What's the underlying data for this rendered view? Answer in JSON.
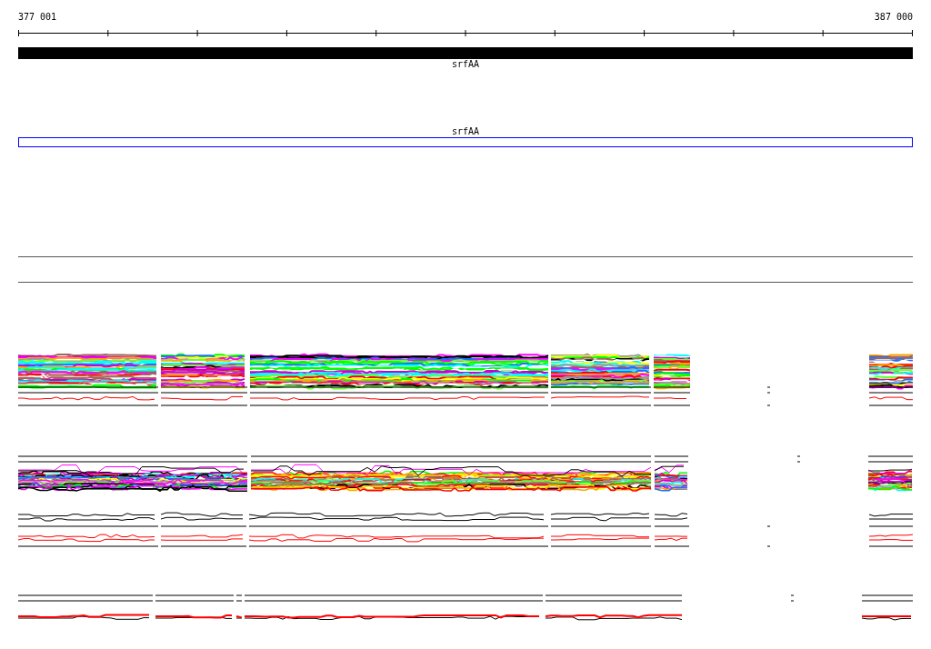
{
  "ruler": {
    "start_label": "377 001",
    "end_label": "387 000"
  },
  "gene": {
    "label": "srfAA"
  },
  "annotation": {
    "label": "srfAA"
  }
}
